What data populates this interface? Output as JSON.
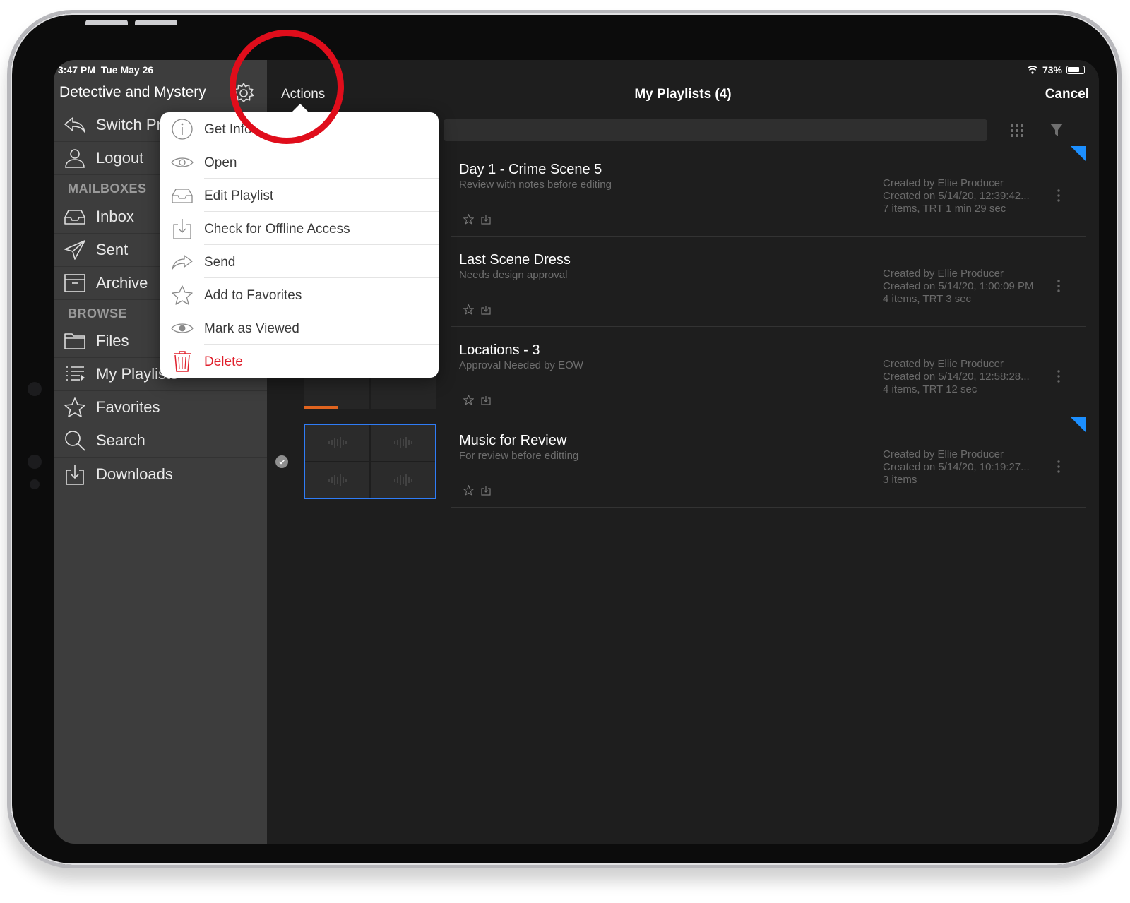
{
  "status": {
    "time": "3:47 PM",
    "date": "Tue May 26",
    "battery": "73%"
  },
  "sidebar": {
    "title": "Detective and Mystery",
    "top_items": [
      {
        "label": "Switch Pro",
        "icon": "reply-arrow-icon"
      },
      {
        "label": "Logout",
        "icon": "person-icon"
      }
    ],
    "mailboxes_heading": "MAILBOXES",
    "mailboxes": [
      {
        "label": "Inbox",
        "icon": "inbox-tray-icon"
      },
      {
        "label": "Sent",
        "icon": "paper-plane-icon"
      },
      {
        "label": "Archive",
        "icon": "archive-box-icon"
      }
    ],
    "browse_heading": "BROWSE",
    "browse": [
      {
        "label": "Files",
        "icon": "folder-icon"
      },
      {
        "label": "My Playlists",
        "icon": "playlist-icon"
      },
      {
        "label": "Favorites",
        "icon": "star-icon"
      },
      {
        "label": "Search",
        "icon": "magnifier-icon"
      },
      {
        "label": "Downloads",
        "icon": "download-icon"
      }
    ]
  },
  "header": {
    "actions": "Actions",
    "title": "My Playlists (4)",
    "cancel": "Cancel"
  },
  "menu": {
    "items": [
      {
        "label": "Get Info",
        "icon": "info-circle-icon"
      },
      {
        "label": "Open",
        "icon": "eye-icon"
      },
      {
        "label": "Edit Playlist",
        "icon": "tray-icon"
      },
      {
        "label": "Check for Offline Access",
        "icon": "download-box-icon"
      },
      {
        "label": "Send",
        "icon": "share-arrow-icon"
      },
      {
        "label": "Add to Favorites",
        "icon": "star-outline-icon"
      },
      {
        "label": "Mark as Viewed",
        "icon": "eye-solid-icon"
      },
      {
        "label": "Delete",
        "icon": "trash-icon"
      }
    ]
  },
  "playlists": [
    {
      "title": "Day 1 - Crime Scene 5",
      "description": "Review with notes before editing",
      "created_by": "Created by Ellie Producer",
      "created_on": "Created on 5/14/20, 12:39:42...",
      "items": "7 items, TRT 1 min 29 sec"
    },
    {
      "title": "Last Scene Dress",
      "description": "Needs design approval",
      "created_by": "Created by Ellie Producer",
      "created_on": "Created on 5/14/20, 1:00:09 PM",
      "items": "4 items, TRT 3 sec"
    },
    {
      "title": "Locations - 3",
      "description": "Approval Needed by EOW",
      "created_by": "Created by Ellie Producer",
      "created_on": "Created on 5/14/20, 12:58:28...",
      "items": "4 items, TRT 12 sec"
    },
    {
      "title": "Music for Review",
      "description": "For review before editting",
      "created_by": "Created by Ellie Producer",
      "created_on": "Created on 5/14/20, 10:19:27...",
      "items": "3 items"
    }
  ],
  "colors": {
    "accent_blue": "#1c8fff",
    "delete_red": "#e0202c",
    "annotation_ring": "#e00d1b",
    "progress_orange": "#e0641f"
  }
}
